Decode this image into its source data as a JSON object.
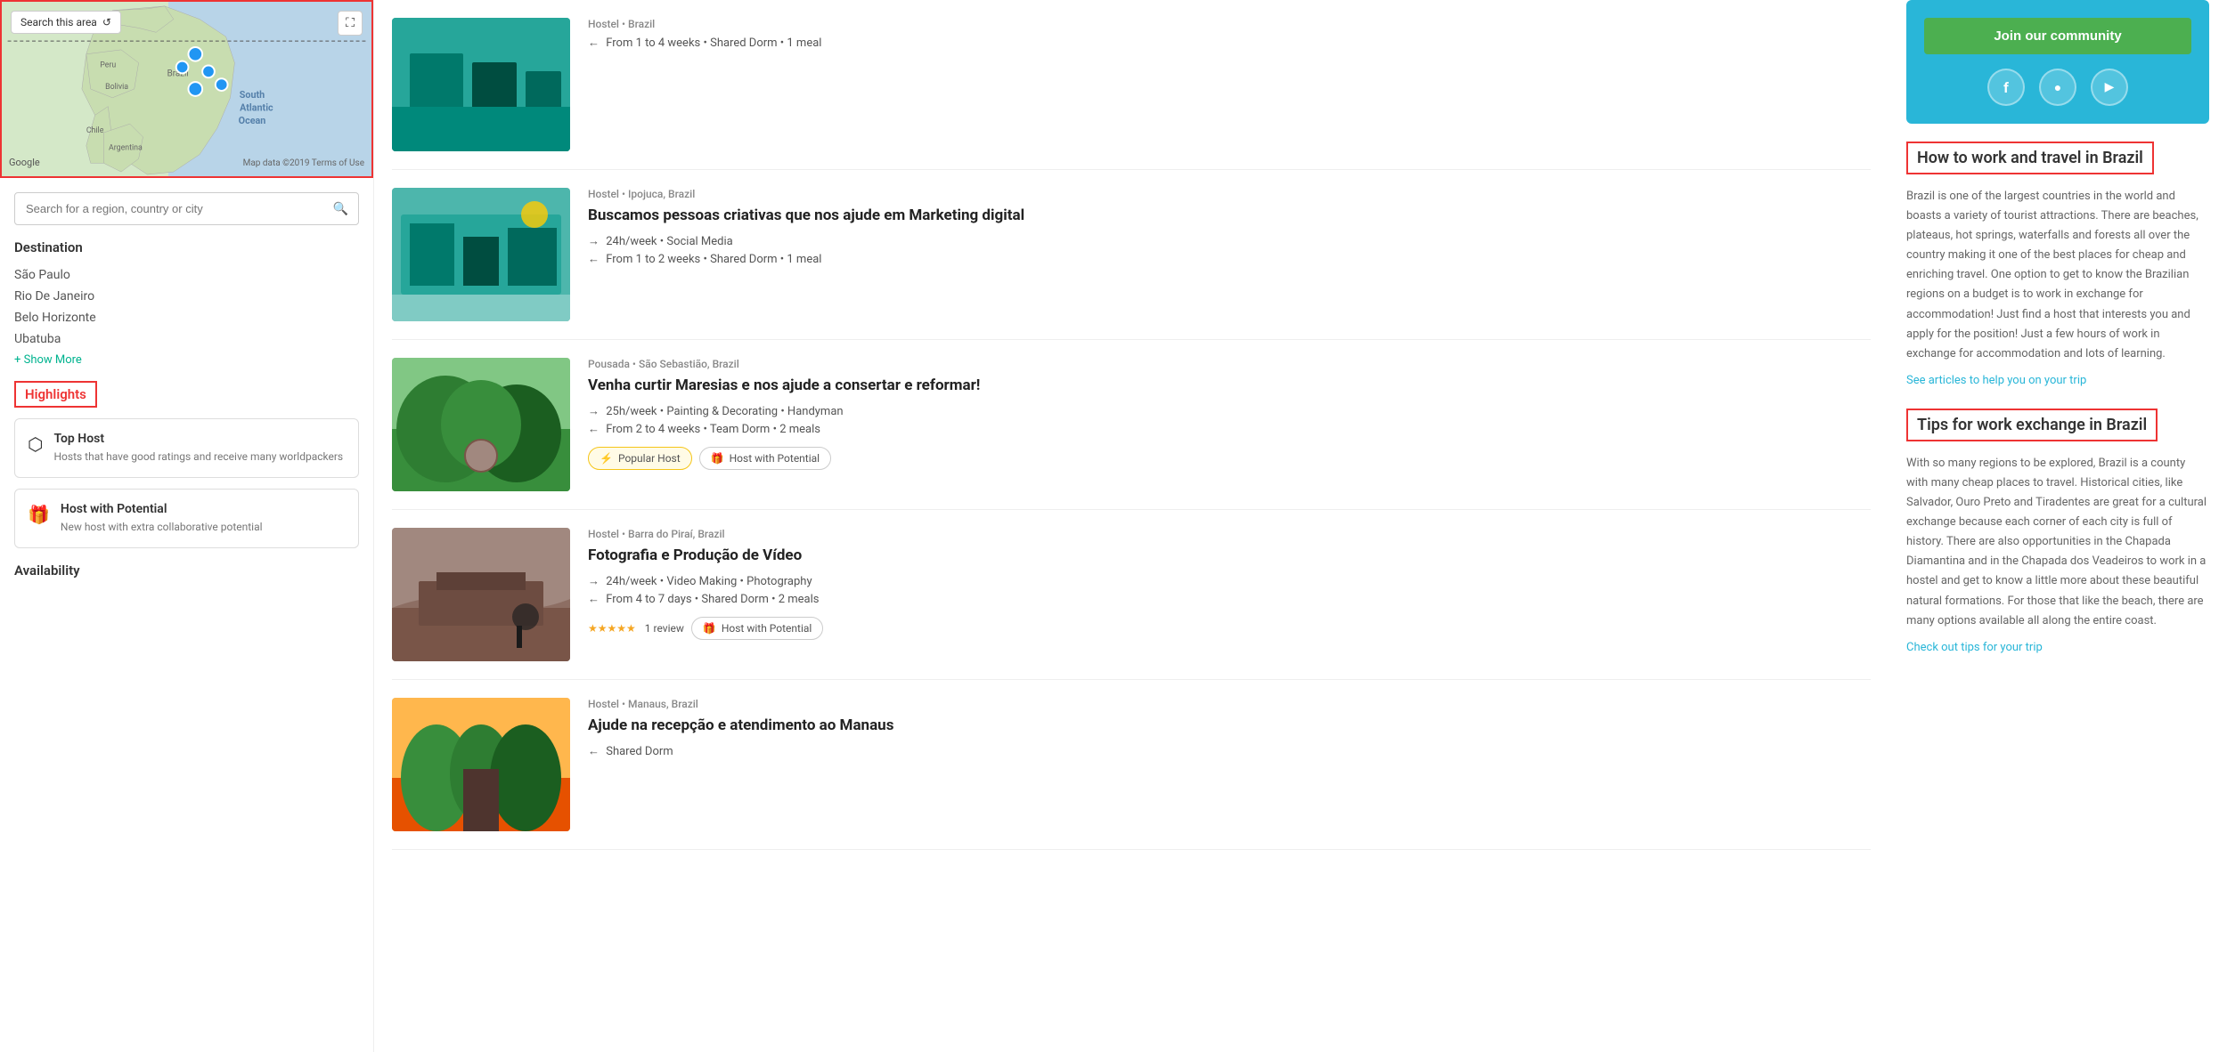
{
  "sidebar": {
    "map": {
      "search_btn": "Search this area",
      "ocean_label": "South\nAtlantic\nOcean",
      "google_label": "Google",
      "attribution": "Map data ©2019  Terms of Use"
    },
    "search": {
      "placeholder": "Search for a region, country or city"
    },
    "destination": {
      "title": "Destination",
      "links": [
        "São Paulo",
        "Rio De Janeiro",
        "Belo Horizonte",
        "Ubatuba"
      ],
      "show_more": "+ Show More"
    },
    "highlights": {
      "title": "Highlights",
      "cards": [
        {
          "icon": "trophy",
          "title": "Top Host",
          "desc": "Hosts that have good ratings and receive many worldpackers"
        },
        {
          "icon": "gift",
          "title": "Host with Potential",
          "desc": "New host with extra collaborative potential"
        }
      ]
    },
    "availability_title": "Availability"
  },
  "listings": [
    {
      "id": 1,
      "img_class": "img-teal",
      "type": "Hostel",
      "location": "Ipojuca, Brazil",
      "title": "Buscamos pessoas criativas que nos ajude em Marketing digital",
      "hours": "24h/week",
      "skill": "Social Media",
      "duration": "From 1 to 2 weeks",
      "accommodation": "Shared Dorm",
      "meals": "1 meal",
      "tags": [],
      "stars": 0,
      "reviews": 0
    },
    {
      "id": 2,
      "img_class": "img-forest",
      "type": "Pousada",
      "location": "São Sebastião, Brazil",
      "title": "Venha curtir Maresias e nos ajude a consertar e reformar!",
      "hours": "25h/week",
      "skill": "Painting & Decorating • Handyman",
      "duration": "From 2 to 4 weeks",
      "accommodation": "Team Dorm",
      "meals": "2 meals",
      "tags": [
        {
          "type": "popular",
          "label": "Popular Host"
        },
        {
          "type": "potential",
          "label": "Host with Potential"
        }
      ],
      "stars": 0,
      "reviews": 0
    },
    {
      "id": 3,
      "img_class": "img-brown",
      "type": "Hostel",
      "location": "Barra do Piraí, Brazil",
      "title": "Fotografia e Produção de Vídeo",
      "hours": "24h/week",
      "skill": "Video Making • Photography",
      "duration": "From 4 to 7 days",
      "accommodation": "Shared Dorm",
      "meals": "2 meals",
      "tags": [
        {
          "type": "potential",
          "label": "Host with Potential"
        }
      ],
      "stars": 5,
      "reviews": 1
    },
    {
      "id": 4,
      "img_class": "img-orange",
      "type": "Hostel",
      "location": "Manaus, Brazil",
      "title": "Ajude na recepção e atendimento ao Manaus",
      "hours": "",
      "skill": "",
      "duration": "",
      "accommodation": "Shared Dorm",
      "meals": "",
      "tags": [],
      "stars": 0,
      "reviews": 0
    }
  ],
  "top_listing": {
    "type": "Hostel",
    "location": "Brazil",
    "accommodation": "Shared Dorm",
    "meals": "1 meal",
    "duration": "From 1 to 4 weeks"
  },
  "right_sidebar": {
    "join_btn": "Join our community",
    "social": {
      "facebook": "f",
      "instagram": "ig",
      "youtube": "yt"
    },
    "article1": {
      "title": "How to work and travel in Brazil",
      "body": "Brazil is one of the largest countries in the world and boasts a variety of tourist attractions. There are beaches, plateaus, hot springs, waterfalls and forests all over the country making it one of the best places for cheap and enriching travel. One option to get to know the Brazilian regions on a budget is to work in exchange for accommodation! Just find a host that interests you and apply for the position! Just a few hours of work in exchange for accommodation and lots of learning.",
      "link": "See articles to help you on your trip"
    },
    "article2": {
      "title": "Tips for work exchange in Brazil",
      "body": "With so many regions to be explored, Brazil is a county with many cheap places to travel. Historical cities, like Salvador, Ouro Preto and Tiradentes are great for a cultural exchange because each corner of each city is full of history. There are also opportunities in the Chapada Diamantina and in the Chapada dos Veadeiros to work in a hostel and get to know a little more about these beautiful natural formations. For those that like the beach, there are many options available all along the entire coast.",
      "link": "Check out tips for your trip"
    },
    "potential_badge1": "Host with Potential",
    "potential_badge2": "Host with Potential",
    "shared_dorm1": "Shared Dorm",
    "shared_dorm2": "Shared Dorm"
  },
  "icons": {
    "search": "🔍",
    "trophy": "⬡",
    "gift": "🎁",
    "lightning": "⚡",
    "star": "★",
    "expand": "⛶",
    "refresh": "↺",
    "arrow_right": "→",
    "arrow_left": "←"
  }
}
